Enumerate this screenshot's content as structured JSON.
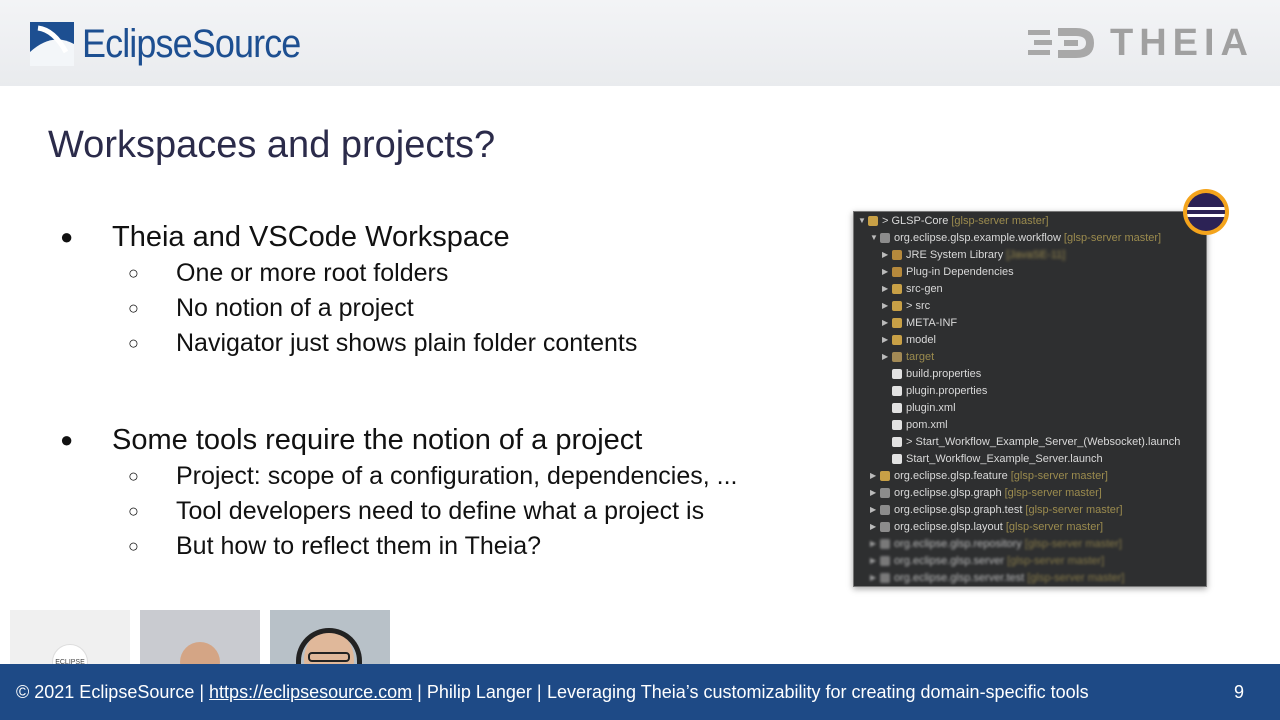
{
  "header": {
    "left_logo_text": "EclipseSource",
    "right_logo_text": "THEIA"
  },
  "slide": {
    "title": "Workspaces and projects?",
    "bullets": [
      {
        "text": "Theia and VSCode Workspace",
        "sub": [
          "One or more root folders",
          "No notion of a project",
          "Navigator just shows plain folder contents"
        ]
      },
      {
        "text": "Some tools require the notion of a project",
        "sub": [
          "Project: scope of a configuration, dependencies, ...",
          "Tool developers need to define what a project is",
          "But how to reflect them in Theia?"
        ]
      }
    ]
  },
  "tree": {
    "rows": [
      {
        "label": "> GLSP-Core",
        "extra": "[glsp-server master]"
      },
      {
        "label": "org.eclipse.glsp.example.workflow",
        "extra": "[glsp-server master]"
      },
      {
        "label": "JRE System Library",
        "extra": "[JavaSE-11]"
      },
      {
        "label": "Plug-in Dependencies",
        "extra": ""
      },
      {
        "label": "src-gen",
        "extra": ""
      },
      {
        "label": "> src",
        "extra": ""
      },
      {
        "label": "META-INF",
        "extra": ""
      },
      {
        "label": "model",
        "extra": ""
      },
      {
        "label": "target",
        "extra": ""
      },
      {
        "label": "build.properties",
        "extra": ""
      },
      {
        "label": "plugin.properties",
        "extra": ""
      },
      {
        "label": "plugin.xml",
        "extra": ""
      },
      {
        "label": "pom.xml",
        "extra": ""
      },
      {
        "label": "> Start_Workflow_Example_Server_(Websocket).launch",
        "extra": ""
      },
      {
        "label": "Start_Workflow_Example_Server.launch",
        "extra": ""
      },
      {
        "label": "org.eclipse.glsp.feature",
        "extra": "[glsp-server master]"
      },
      {
        "label": "org.eclipse.glsp.graph",
        "extra": "[glsp-server master]"
      },
      {
        "label": "org.eclipse.glsp.graph.test",
        "extra": "[glsp-server master]"
      },
      {
        "label": "org.eclipse.glsp.layout",
        "extra": "[glsp-server master]"
      },
      {
        "label": "org.eclipse.glsp.repository",
        "extra": "[glsp-server master]"
      },
      {
        "label": "org.eclipse.glsp.server",
        "extra": "[glsp-server master]"
      },
      {
        "label": "org.eclipse.glsp.server.test",
        "extra": "[glsp-server master]"
      }
    ]
  },
  "thumbnails": {
    "eclipse_label": "ECLIPSE"
  },
  "footer": {
    "copyright": "© 2021 EclipseSource | ",
    "link": "https://eclipsesource.com",
    "author": " | Philip Langer | ",
    "talk": "Leveraging Theia’s customizability for creating domain-specific tools",
    "page": "9"
  },
  "colors": {
    "brand_blue": "#1d4f91",
    "footer_blue": "#1e4a86",
    "title": "#2b2b4a"
  }
}
